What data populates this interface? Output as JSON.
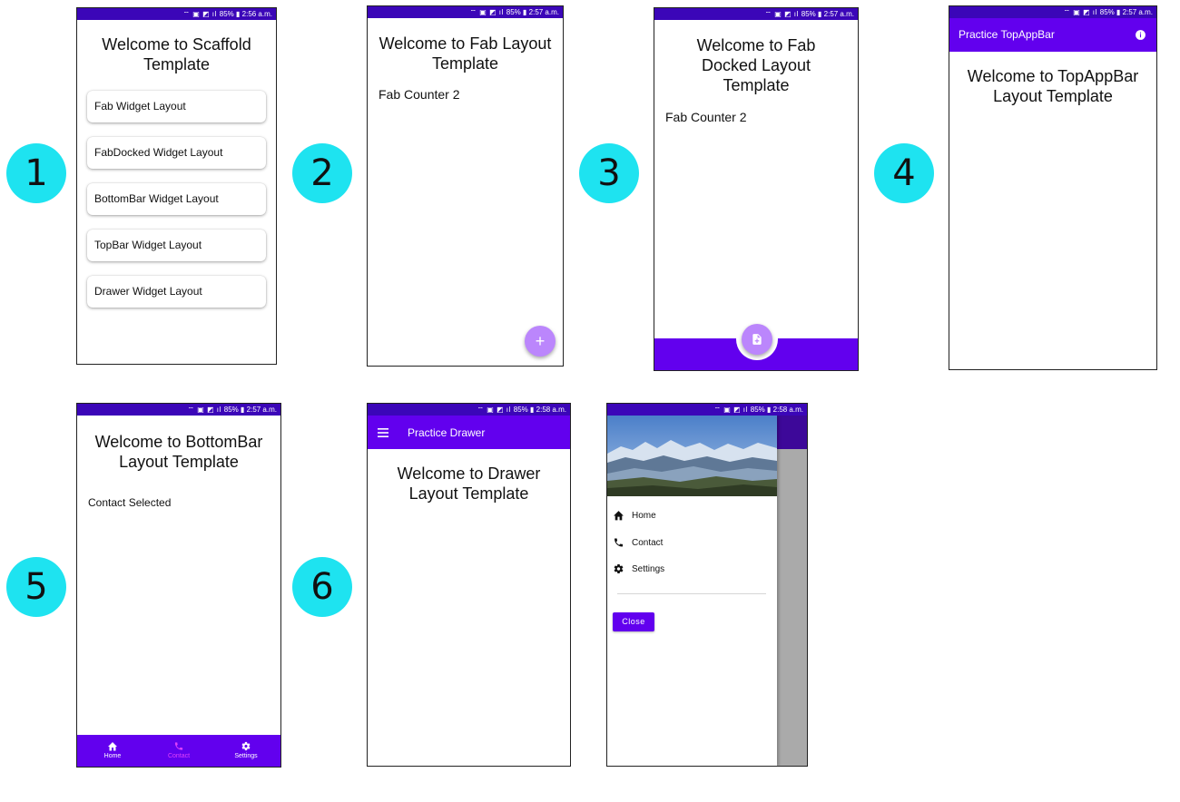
{
  "markers": [
    "1",
    "2",
    "3",
    "4",
    "5",
    "6"
  ],
  "colors": {
    "marker": "#1ee3f0",
    "primary": "#6200ee",
    "status_bar": "#3b06b8",
    "fab": "#bb86fc",
    "accent_selected": "#e040fb"
  },
  "screens": {
    "scaffold": {
      "status_text": "85% ▮ 2:56 a.m.",
      "welcome": "Welcome to Scaffold Template",
      "buttons": [
        "Fab Widget Layout",
        "FabDocked Widget Layout",
        "BottomBar Widget Layout",
        "TopBar Widget Layout",
        "Drawer Widget Layout"
      ]
    },
    "fab": {
      "status_text": "85% ▮ 2:57 a.m.",
      "welcome": "Welcome to Fab Layout Template",
      "counter": "Fab Counter 2",
      "fab_icon": "+"
    },
    "fab_docked": {
      "status_text": "85% ▮ 2:57 a.m.",
      "welcome": "Welcome to Fab Docked Layout Template",
      "counter": "Fab Counter 2",
      "fab_icon": "note-add-icon"
    },
    "topbar": {
      "status_text": "85% ▮ 2:57 a.m.",
      "title": "Practice TopAppBar",
      "action_icon": "info-icon",
      "welcome": "Welcome to TopAppBar Layout Template"
    },
    "bottombar": {
      "status_text": "85% ▮ 2:57 a.m.",
      "welcome": "Welcome to BottomBar Layout Template",
      "selected_text": "Contact Selected",
      "nav": [
        {
          "label": "Home",
          "icon": "home-icon",
          "selected": false
        },
        {
          "label": "Contact",
          "icon": "phone-icon",
          "selected": true
        },
        {
          "label": "Settings",
          "icon": "gear-icon",
          "selected": false
        }
      ]
    },
    "drawer": {
      "status_text": "85% ▮ 2:58 a.m.",
      "title": "Practice Drawer",
      "welcome": "Welcome to Drawer Layout Template"
    },
    "drawer_open": {
      "status_text": "85% ▮ 2:58 a.m.",
      "items": [
        {
          "label": "Home",
          "icon": "home-icon"
        },
        {
          "label": "Contact",
          "icon": "phone-icon"
        },
        {
          "label": "Settings",
          "icon": "gear-icon"
        }
      ],
      "close_label": "Close"
    }
  }
}
